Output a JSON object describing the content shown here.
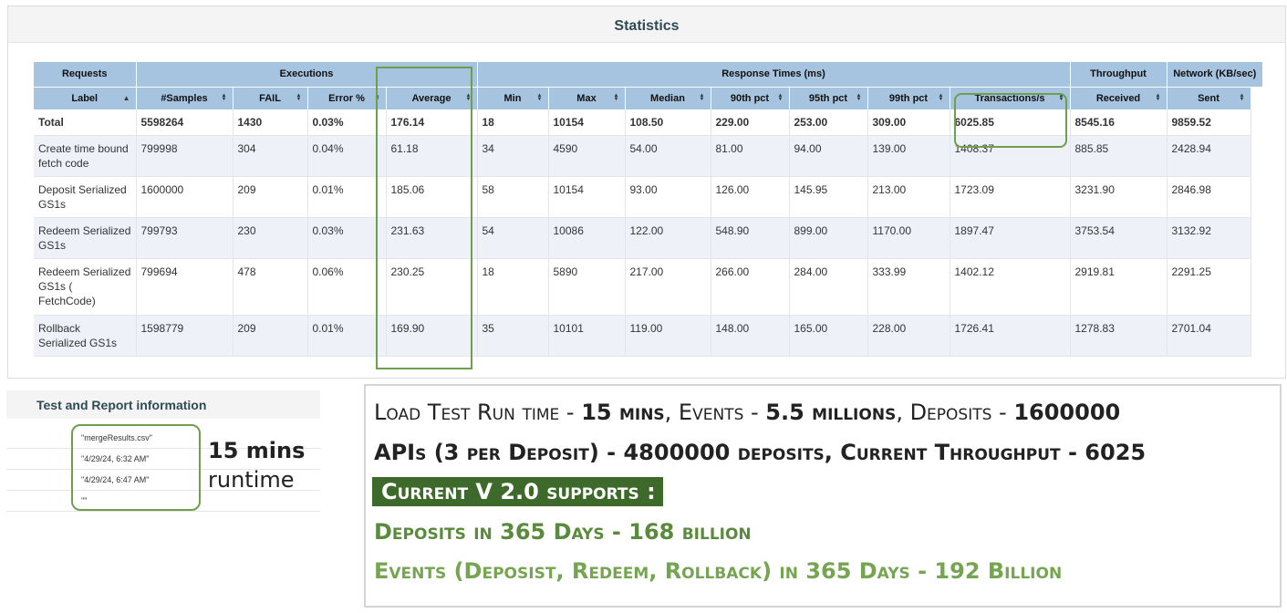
{
  "statistics": {
    "title": "Statistics",
    "groups": [
      "Requests",
      "Executions",
      "Response Times (ms)",
      "Throughput",
      "Network (KB/sec)"
    ],
    "columns": [
      "Label",
      "#Samples",
      "FAIL",
      "Error %",
      "Average",
      "Min",
      "Max",
      "Median",
      "90th pct",
      "95th pct",
      "99th pct",
      "Transactions/s",
      "Received",
      "Sent"
    ],
    "total": [
      "Total",
      "5598264",
      "1430",
      "0.03%",
      "176.14",
      "18",
      "10154",
      "108.50",
      "229.00",
      "253.00",
      "309.00",
      "6025.85",
      "8545.16",
      "9859.52"
    ],
    "rows": [
      [
        "Create time bound fetch code",
        "799998",
        "304",
        "0.04%",
        "61.18",
        "34",
        "4590",
        "54.00",
        "81.00",
        "94.00",
        "139.00",
        "1408.37",
        "885.85",
        "2428.94"
      ],
      [
        "Deposit Serialized GS1s",
        "1600000",
        "209",
        "0.01%",
        "185.06",
        "58",
        "10154",
        "93.00",
        "126.00",
        "145.95",
        "213.00",
        "1723.09",
        "3231.90",
        "2846.98"
      ],
      [
        "Redeem Serialized GS1s",
        "799793",
        "230",
        "0.03%",
        "231.63",
        "54",
        "10086",
        "122.00",
        "548.90",
        "899.00",
        "1170.00",
        "1897.47",
        "3753.54",
        "3132.92"
      ],
      [
        "Redeem Serialized GS1s ( FetchCode)",
        "799694",
        "478",
        "0.06%",
        "230.25",
        "18",
        "5890",
        "217.00",
        "266.00",
        "284.00",
        "333.99",
        "1402.12",
        "2919.81",
        "2291.25"
      ],
      [
        "Rollback Serialized GS1s",
        "1598779",
        "209",
        "0.01%",
        "169.90",
        "35",
        "10101",
        "119.00",
        "148.00",
        "165.00",
        "228.00",
        "1726.41",
        "1278.83",
        "2701.04"
      ]
    ]
  },
  "test_info": {
    "title": "Test and Report information",
    "values": [
      "\"mergeResults.csv\"",
      "\"4/29/24, 6:32 AM\"",
      "\"4/29/24, 6:47 AM\"",
      "\"\""
    ],
    "runtime_mins": "15 mins",
    "runtime_word": "runtime"
  },
  "summary": {
    "line1": {
      "a": "Load Test Run time - ",
      "b": "15 mins",
      "c": ", Events - ",
      "d": "5.5 millions",
      "e": ", Deposits - ",
      "f": "1600000"
    },
    "line2": "APIs (3 per Deposit) - 4800000 deposits, Current Throughput - 6025",
    "line3": "Current V 2.0 supports  :",
    "line4": "Deposits in 365 Days - 168 billion",
    "line5": "Events (Deposist, Redeem, Rollback) in 365 Days - 192 Billion"
  },
  "colors": {
    "header_blue": "#a6c3e0",
    "row_alt": "#eef2f8",
    "highlight_green": "#6f9e4c",
    "banner_green": "#3d6a2a",
    "text_green": "#5a8a3c",
    "text_light_green": "#76a551"
  },
  "icons": {
    "sort": "sort-arrows-icon",
    "sort_asc": "sort-asc-icon"
  }
}
